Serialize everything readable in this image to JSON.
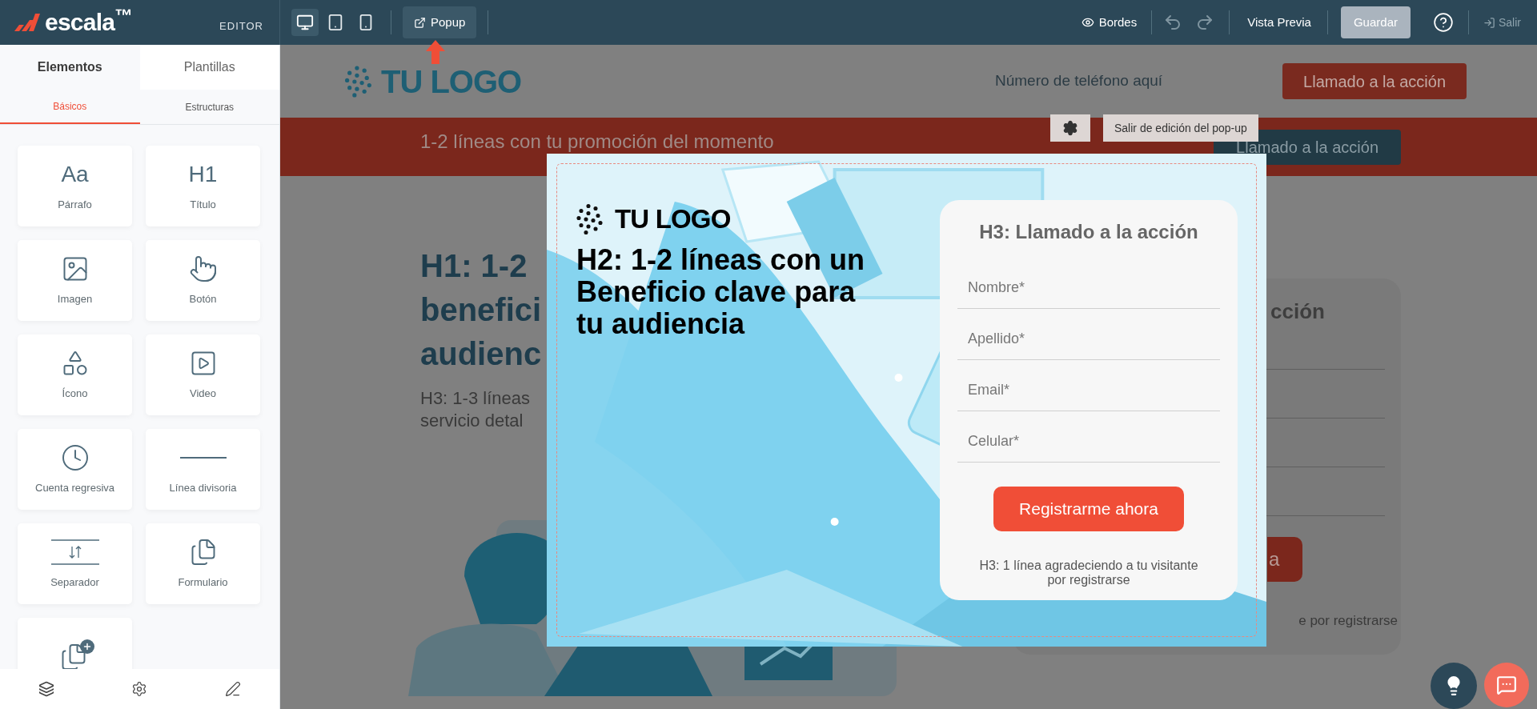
{
  "topbar": {
    "brand": "escala$^{™}$",
    "mode": "EDITOR",
    "devices": [
      {
        "kind": "desktop",
        "selected": true
      },
      {
        "kind": "tablet",
        "selected": false
      },
      {
        "kind": "mobile",
        "selected": false
      }
    ],
    "popup_button": "Popup",
    "borders": "Bordes",
    "preview": "Vista Previa",
    "save": {
      "label": "Guardar",
      "disabled": true
    },
    "exit": "Salir"
  },
  "sidebar": {
    "tabs": [
      {
        "label": "Elementos",
        "selected": true
      },
      {
        "label": "Plantillas",
        "selected": false
      }
    ],
    "subtabs": [
      {
        "label": "Básicos",
        "selected": true
      },
      {
        "label": "Estructuras",
        "selected": false
      }
    ],
    "elements": [
      {
        "kind": "paragraph",
        "glyph": "Aa",
        "label": "Párrafo"
      },
      {
        "kind": "title",
        "glyph": "H1",
        "label": "Título"
      },
      {
        "kind": "image",
        "label": "Imagen"
      },
      {
        "kind": "button",
        "label": "Botón"
      },
      {
        "kind": "icon",
        "label": "Ícono"
      },
      {
        "kind": "video",
        "label": "Video"
      },
      {
        "kind": "countdown",
        "label": "Cuenta regresiva"
      },
      {
        "kind": "divider",
        "label": "Línea divisoria"
      },
      {
        "kind": "separator",
        "label": "Separador"
      },
      {
        "kind": "form",
        "label": "Formulario"
      },
      {
        "kind": "form-add"
      }
    ]
  },
  "page": {
    "logo": "TU LOGO",
    "phone": "Número de teléfono aquí",
    "header_cta": "Llamado a la acción",
    "promo": "1-2 líneas con tu promoción del momento",
    "promo_cta": "Llamado a la acción",
    "hero_title_lines": [
      "H1: 1-2",
      "benefici",
      "audienc"
    ],
    "hero_subtitle_lines": [
      "H3: 1-3 líneas",
      "servicio detal"
    ],
    "form_title_fragment": "cción",
    "form_button_fragment": "a",
    "form_note_fragment": "e por registrarse"
  },
  "popup_toolbar": {
    "exit": "Salir de edición del pop-up"
  },
  "popup": {
    "logo": "TU LOGO",
    "headline_lines": [
      "H2: 1-2 líneas con un",
      "Beneficio clave para",
      "tu audiencia"
    ],
    "form": {
      "title": "H3: Llamado a la acción",
      "fields": [
        {
          "placeholder": "Nombre*"
        },
        {
          "placeholder": "Apellido*"
        },
        {
          "placeholder": "Email*"
        },
        {
          "placeholder": "Celular*"
        }
      ],
      "submit": "Registrarme ahora",
      "note": "H3: 1 línea agradeciendo a tu visitante por registrarse"
    }
  }
}
